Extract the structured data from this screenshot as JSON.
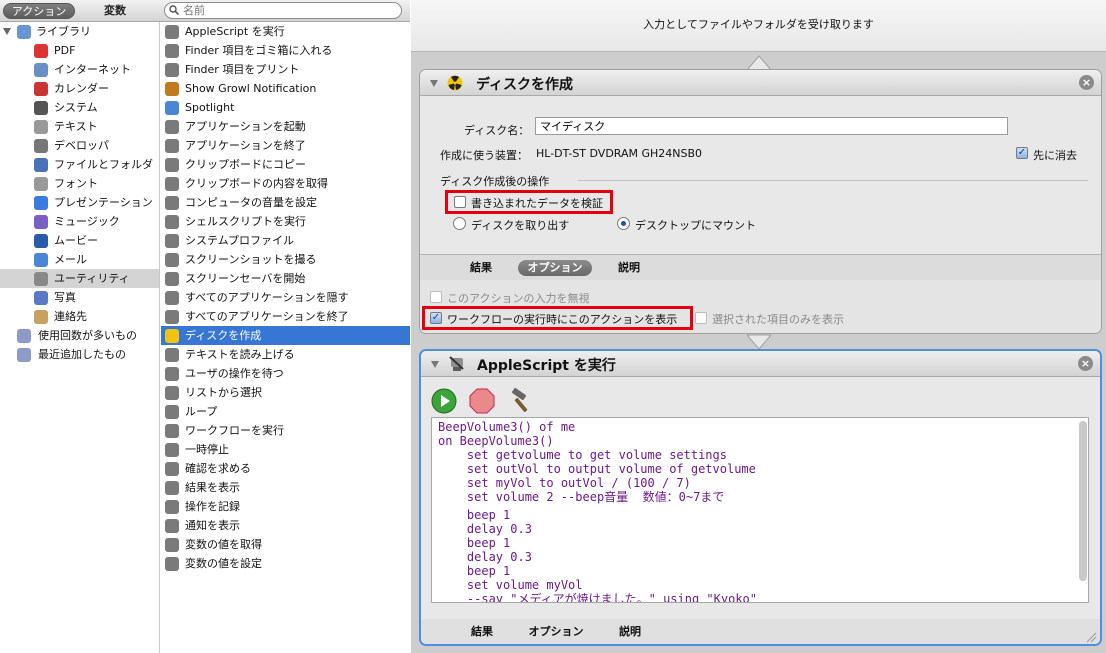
{
  "left_panel": {
    "tabs": {
      "actions": "アクション",
      "variables": "変数"
    },
    "search_placeholder": "名前",
    "library": {
      "root": "ライブラリ",
      "items": [
        "PDF",
        "インターネット",
        "カレンダー",
        "システム",
        "テキスト",
        "デベロッパ",
        "ファイルとフォルダ",
        "フォント",
        "プレゼンテーション",
        "ミュージック",
        "ムービー",
        "メール",
        "ユーティリティ",
        "写真",
        "連絡先"
      ],
      "smart_groups": [
        "使用回数が多いもの",
        "最近追加したもの"
      ]
    },
    "actions": [
      "AppleScript を実行",
      "Finder 項目をゴミ箱に入れる",
      "Finder 項目をプリント",
      "Show Growl Notification",
      "Spotlight",
      "アプリケーションを起動",
      "アプリケーションを終了",
      "クリップボードにコピー",
      "クリップボードの内容を取得",
      "コンピュータの音量を設定",
      "シェルスクリプトを実行",
      "システムプロファイル",
      "スクリーンショットを撮る",
      "スクリーンセーバを開始",
      "すべてのアプリケーションを隠す",
      "すべてのアプリケーションを終了",
      "ディスクを作成",
      "テキストを読み上げる",
      "ユーザの操作を待つ",
      "リストから選択",
      "ループ",
      "ワークフローを実行",
      "一時停止",
      "確認を求める",
      "結果を表示",
      "操作を記録",
      "通知を表示",
      "変数の値を取得",
      "変数の値を設定"
    ]
  },
  "workflow": {
    "receives": "入力としてファイルやフォルダを受け取ります",
    "burn": {
      "title": "ディスクを作成",
      "disk_name_label": "ディスク名：",
      "disk_name_value": "マイディスク",
      "device_label": "作成に使う装置：",
      "device_value": "HL-DT-ST DVDRAM GH24NSB0",
      "erase_label": "先に消去",
      "after_section": "ディスク作成後の操作",
      "verify_label": "書き込まれたデータを検証",
      "eject_label": "ディスクを取り出す",
      "mount_label": "デスクトップにマウント",
      "tabs": [
        "結果",
        "オプション",
        "説明"
      ],
      "ignore_input": "このアクションの入力を無視",
      "show_when_run": "ワークフローの実行時にこのアクションを表示",
      "selected_only": "選択された項目のみを表示"
    },
    "applescript": {
      "title": "AppleScript を実行",
      "code": [
        "BeepVolume3() of me",
        "on BeepVolume3()",
        "    set getvolume to get volume settings",
        "    set outVol to output volume of getvolume",
        "    set myVol to outVol / (100 / 7)",
        "    set volume 2 --beep音量  数値：0~7まで",
        "    beep 1",
        "    delay 0.3",
        "    beep 1",
        "    delay 0.3",
        "    beep 1",
        "    set volume myVol",
        "    --say \"メディアが焼けました。\" using \"Kyoko\""
      ],
      "tabs": [
        "結果",
        "オプション",
        "説明"
      ]
    }
  },
  "colors": {
    "selection": "#3876d6",
    "highlight": "#e3000f",
    "code_text": "#6b1a87"
  }
}
